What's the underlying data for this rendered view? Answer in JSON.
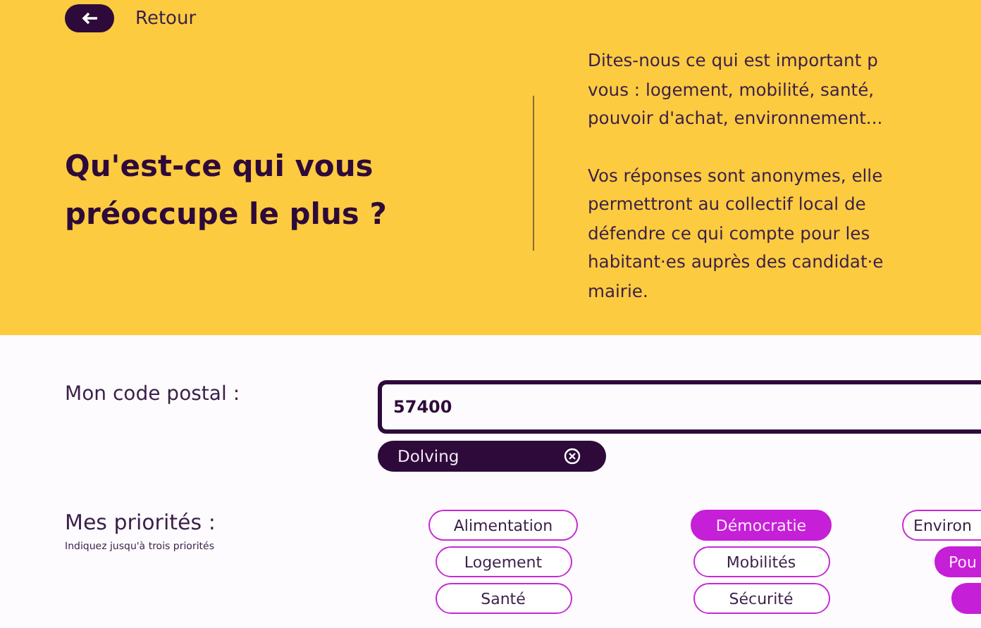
{
  "header": {
    "back_button": {
      "label": "Retour"
    },
    "title": "Qu'est-ce qui vous préoccupe le plus ?",
    "intro": [
      [
        "Dites-nous ce qui est important p",
        "vous : logement, mobilité, santé,",
        "pouvoir d'achat, environnement..."
      ],
      [
        "Vos réponses sont anonymes, elle",
        "permettront au collectif local de",
        "défendre ce qui compte pour les",
        "habitant·es auprès des candidat·e",
        "mairie."
      ]
    ]
  },
  "postal_code": {
    "label": "Mon code postal :",
    "value": "57400",
    "chips": [
      {
        "label": "Dolving"
      }
    ]
  },
  "priorities": {
    "label": "Mes priorités :",
    "hint": "Indiquez jusqu'à trois priorités",
    "columns": [
      [
        {
          "label": "Alimentation",
          "selected": false
        },
        {
          "label": "Logement",
          "selected": false
        },
        {
          "label": "Santé",
          "selected": false
        }
      ],
      [
        {
          "label": "Démocratie",
          "selected": true
        },
        {
          "label": "Mobilités",
          "selected": false
        },
        {
          "label": "Sécurité",
          "selected": false
        }
      ],
      [
        {
          "label": "Environ",
          "selected": false
        },
        {
          "label": "Pou",
          "selected": true
        },
        {
          "selected": true
        }
      ]
    ]
  }
}
